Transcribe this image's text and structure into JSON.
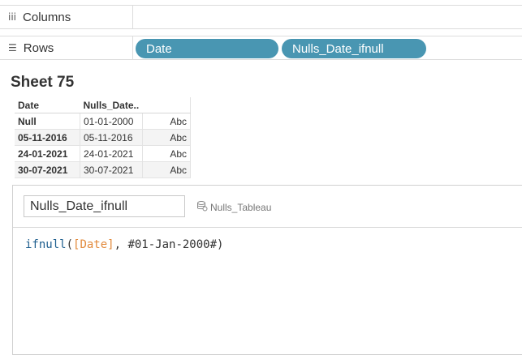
{
  "columns_shelf": {
    "label": "Columns",
    "icon": "columns-icon"
  },
  "rows_shelf": {
    "label": "Rows",
    "icon": "rows-icon",
    "pills": [
      "Date",
      "Nulls_Date_ifnull"
    ]
  },
  "colors": {
    "pill": "#4996b2",
    "function": "#1f5f8f",
    "field": "#e28a3c"
  },
  "sheet": {
    "title": "Sheet 75"
  },
  "table": {
    "headers": [
      "Date",
      "Nulls_Date..",
      ""
    ],
    "rows": [
      [
        "Null",
        "01-01-2000",
        "Abc"
      ],
      [
        "05-11-2016",
        "05-11-2016",
        "Abc"
      ],
      [
        "24-01-2021",
        "24-01-2021",
        "Abc"
      ],
      [
        "30-07-2021",
        "30-07-2021",
        "Abc"
      ]
    ]
  },
  "calc_editor": {
    "name_value": "Nulls_Date_ifnull",
    "datasource": "Nulls_Tableau",
    "datasource_icon": "database-icon",
    "formula": {
      "fn": "ifnull",
      "open": "(",
      "field": "[Date]",
      "rest": ", #01-Jan-2000#)"
    }
  }
}
